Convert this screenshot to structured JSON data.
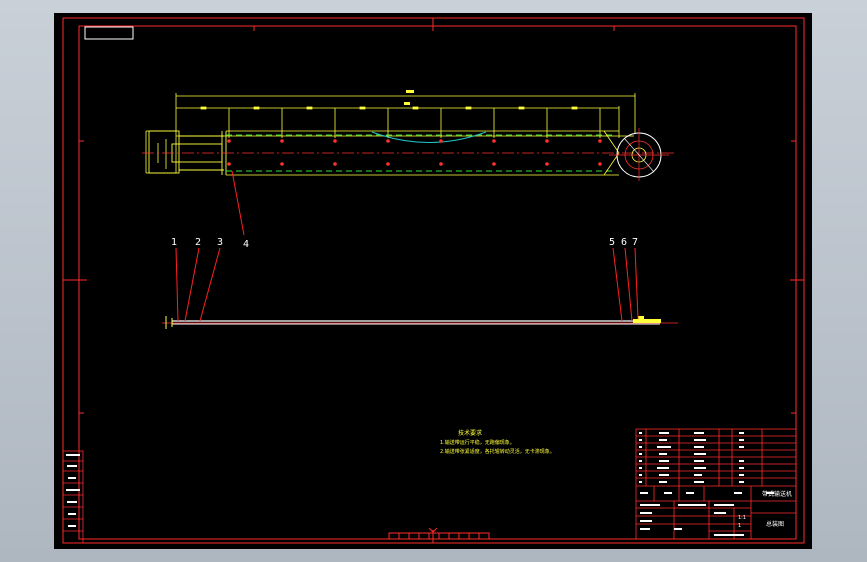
{
  "viewport": {
    "background": "#000000",
    "frame_color": "#ff0000"
  },
  "colors": {
    "frame": "#ff2a2a",
    "dimension": "#ffff3c",
    "belt": "#ffffff",
    "centerline": "#ff3030",
    "hidden": "#36e836",
    "sag": "#22c4c4",
    "leader": "#ff2020"
  },
  "part_labels": {
    "plan": [
      "4"
    ],
    "side": [
      "1",
      "2",
      "3",
      "5",
      "6",
      "7"
    ]
  },
  "notes": {
    "title": "技术要求",
    "lines": [
      "1.输送带运行平稳，无跑偏现象。",
      "2.输送带张紧适度，各托辊转动灵活，无卡滞现象。"
    ]
  },
  "title_block": {
    "drawing_name": "带式输送机",
    "drawing_no": "总装图",
    "scale": "1:1",
    "sheet": "1"
  }
}
